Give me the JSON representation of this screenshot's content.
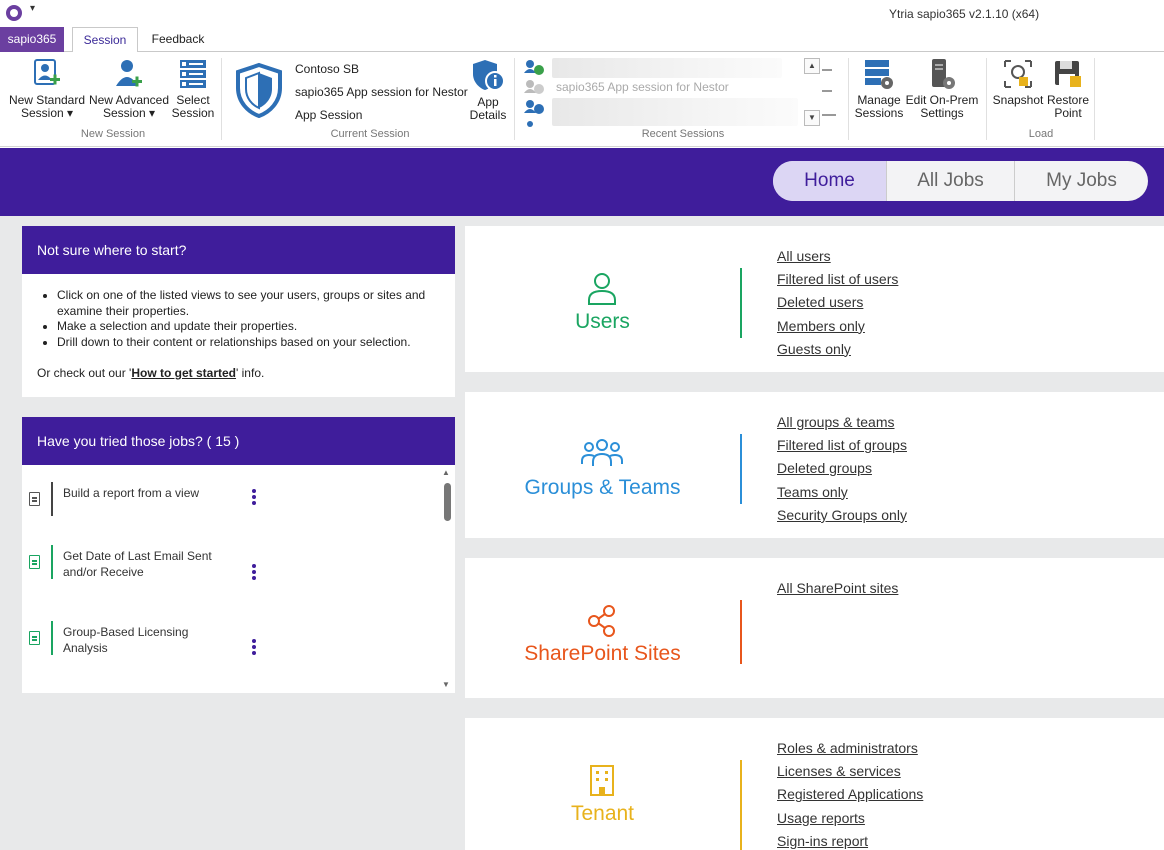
{
  "window": {
    "title": "Ytria sapio365 v2.1.10 (x64)",
    "qat": "▾"
  },
  "tabs": {
    "app": "sapio365",
    "session": "Session",
    "feedback": "Feedback"
  },
  "ribbon": {
    "new_standard_1": "New Standard",
    "new_standard_2": "Session ▾",
    "new_advanced_1": "New Advanced",
    "new_advanced_2": "Session ▾",
    "select_1": "Select",
    "select_2": "Session",
    "new_session_group": "New Session",
    "current_tenant": "Contoso SB",
    "current_session_name": "sapio365 App session for Nestor",
    "current_session_type": "App Session",
    "app_details_1": "App",
    "app_details_2": "Details",
    "current_session_group": "Current Session",
    "recent_visible": "sapio365 App session for Nestor",
    "recent_group": "Recent Sessions",
    "manage_1": "Manage",
    "manage_2": "Sessions",
    "onprem_1": "Edit On-Prem",
    "onprem_2": "Settings",
    "snapshot": "Snapshot",
    "restore_1": "Restore",
    "restore_2": "Point",
    "load_group": "Load"
  },
  "nav": {
    "home": "Home",
    "all_jobs": "All Jobs",
    "my_jobs": "My Jobs",
    "active": "Home"
  },
  "start_panel": {
    "title": "Not sure where to start?",
    "bullets": [
      "Click on one of the listed views to see your users, groups or sites and examine their properties.",
      "Make a selection and update their properties.",
      "Drill down to their content or relationships based on your selection."
    ],
    "checkout_pre": "Or check out our '",
    "checkout_link": "How to get started",
    "checkout_post": "' info."
  },
  "jobs_panel": {
    "title": "Have you tried those jobs? ( 15 )",
    "jobs": [
      {
        "label": "Build a report from a view"
      },
      {
        "label": "Get Date of Last Email Sent and/or Receive"
      },
      {
        "label": "Group-Based Licensing Analysis"
      }
    ]
  },
  "cards": {
    "users": {
      "title": "Users",
      "color": "#1aa561",
      "links": [
        "All users",
        "Filtered list of users",
        "Deleted users",
        "Members only",
        "Guests only"
      ]
    },
    "groups": {
      "title": "Groups & Teams",
      "color": "#2b8fd8",
      "links": [
        "All groups & teams",
        "Filtered list of groups",
        "Deleted groups",
        "Teams only",
        "Security Groups only"
      ]
    },
    "sharepoint": {
      "title": "SharePoint Sites",
      "color": "#e8561c",
      "links": [
        "All SharePoint sites"
      ]
    },
    "tenant": {
      "title": "Tenant",
      "color": "#e8b21c",
      "links": [
        "Roles & administrators",
        "Licenses & services",
        "Registered Applications",
        "Usage reports",
        "Sign-ins report"
      ]
    }
  },
  "icons": [
    "app-logo-icon",
    "new-standard-session-icon",
    "new-advanced-session-icon",
    "select-session-icon",
    "shield-icon",
    "app-details-icon",
    "recent-session-icon",
    "manage-sessions-icon",
    "on-prem-settings-icon",
    "snapshot-icon",
    "restore-point-icon",
    "user-icon",
    "group-icon",
    "share-icon",
    "building-icon",
    "document-icon",
    "more-vertical-icon"
  ]
}
